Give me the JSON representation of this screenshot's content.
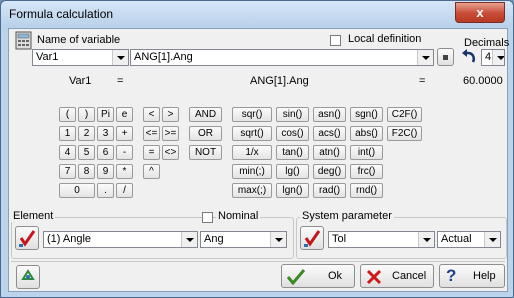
{
  "window": {
    "title": "Formula calculation",
    "close_glyph": "x"
  },
  "header": {
    "name_label": "Name of variable",
    "local_label": "Local definition",
    "decimals_label": "Decimals",
    "name_value": "Var1",
    "formula_value": "ANG[1].Ang",
    "decimals_value": "4"
  },
  "result": {
    "var": "Var1",
    "eq1": "=",
    "formula": "ANG[1].Ang",
    "eq2": "=",
    "value": "60.0000"
  },
  "keypad": {
    "num": [
      "(",
      ")",
      "Pi",
      "e",
      "1",
      "2",
      "3",
      "+",
      "4",
      "5",
      "6",
      "-",
      "7",
      "8",
      "9",
      "*",
      "0",
      ".",
      "/"
    ],
    "cmp": [
      "<",
      ">",
      "<=",
      ">=",
      "=",
      "<>",
      "^"
    ],
    "logic": [
      "AND",
      "OR",
      "NOT"
    ],
    "funcs": [
      "sqr()",
      "sin()",
      "asn()",
      "sgn()",
      "C2F()",
      "sqrt()",
      "cos()",
      "acs()",
      "abs()",
      "F2C()",
      "1/x",
      "tan()",
      "atn()",
      "int()",
      "min(;)",
      "lg()",
      "deg()",
      "frc()",
      "max(;)",
      "lgn()",
      "rad()",
      "rnd()"
    ]
  },
  "element": {
    "label": "Element",
    "nominal_label": "Nominal",
    "value": "(1) Angle",
    "attr": "Ang"
  },
  "system": {
    "label": "System parameter",
    "value": "Tol",
    "mode": "Actual"
  },
  "buttons": {
    "ok": "Ok",
    "cancel": "Cancel",
    "help": "Help"
  }
}
